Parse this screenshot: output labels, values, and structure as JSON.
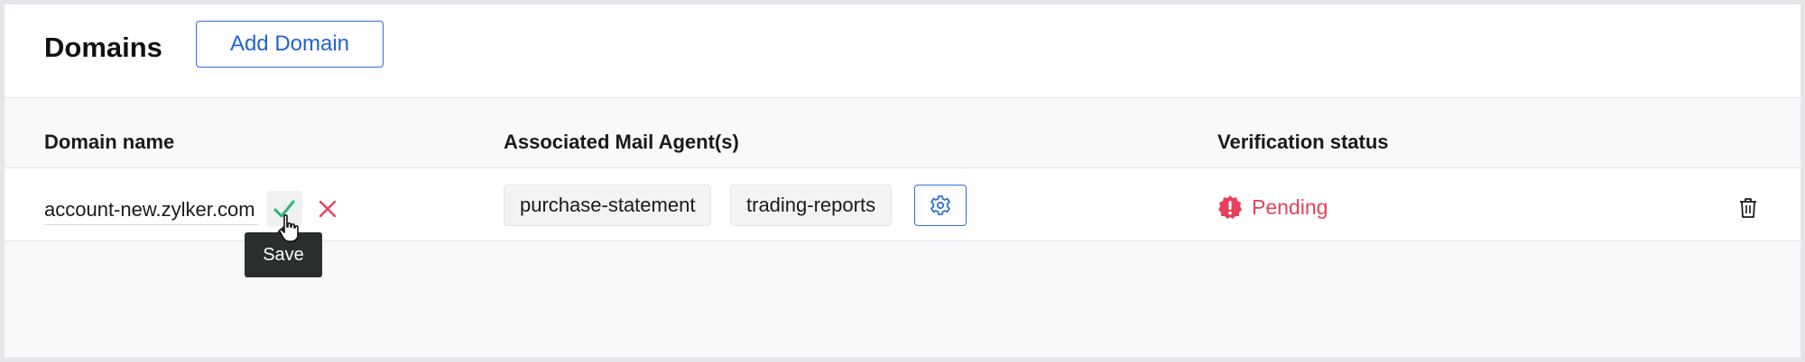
{
  "header": {
    "title": "Domains",
    "add_button_label": "Add Domain"
  },
  "table": {
    "columns": [
      "Domain name",
      "Associated Mail Agent(s)",
      "Verification status"
    ],
    "rows": [
      {
        "domain_value": "account-new.zylker.com",
        "mail_agents": [
          "purchase-statement",
          "trading-reports"
        ],
        "status": "Pending"
      }
    ]
  },
  "tooltip": "Save",
  "colors": {
    "accent": "#1f63d6",
    "confirm": "#2bb673",
    "cancel": "#e8405a",
    "pending": "#e8405a",
    "tooltip_bg": "#2b2f2b"
  },
  "icons": {
    "confirm": "check-icon",
    "cancel": "close-icon",
    "settings": "gear-icon",
    "status": "alert-badge-icon",
    "delete": "trash-icon"
  }
}
